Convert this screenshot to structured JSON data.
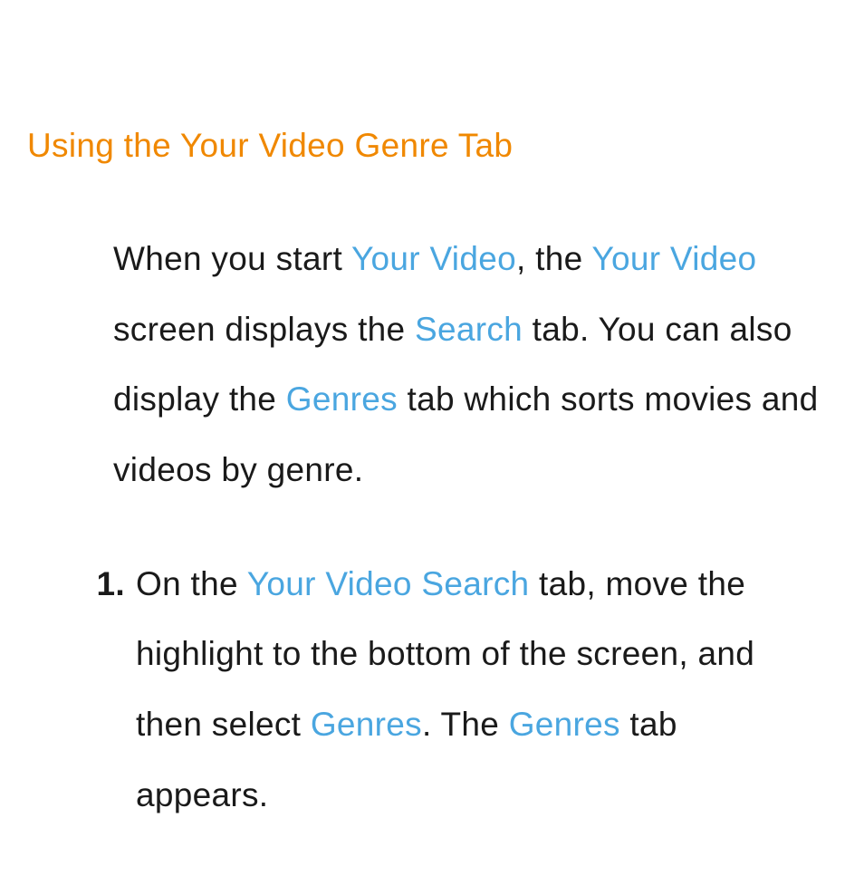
{
  "heading": "Using the Your Video Genre Tab",
  "intro": {
    "t1": "When you start ",
    "h1": "Your Video",
    "t2": ", the ",
    "h2": "Your Video",
    "t3": " screen displays the ",
    "h3": "Search",
    "t4": " tab. You can also display the ",
    "h4": "Genres",
    "t5": " tab which sorts movies and videos by genre."
  },
  "step1": {
    "num": "1.",
    "t1": "On the ",
    "h1": "Your Video Search",
    "t2": " tab, move the highlight to the bottom of the screen, and then select ",
    "h2": "Genres",
    "t3": ". The ",
    "h3": "Genres",
    "t4": " tab appears."
  }
}
